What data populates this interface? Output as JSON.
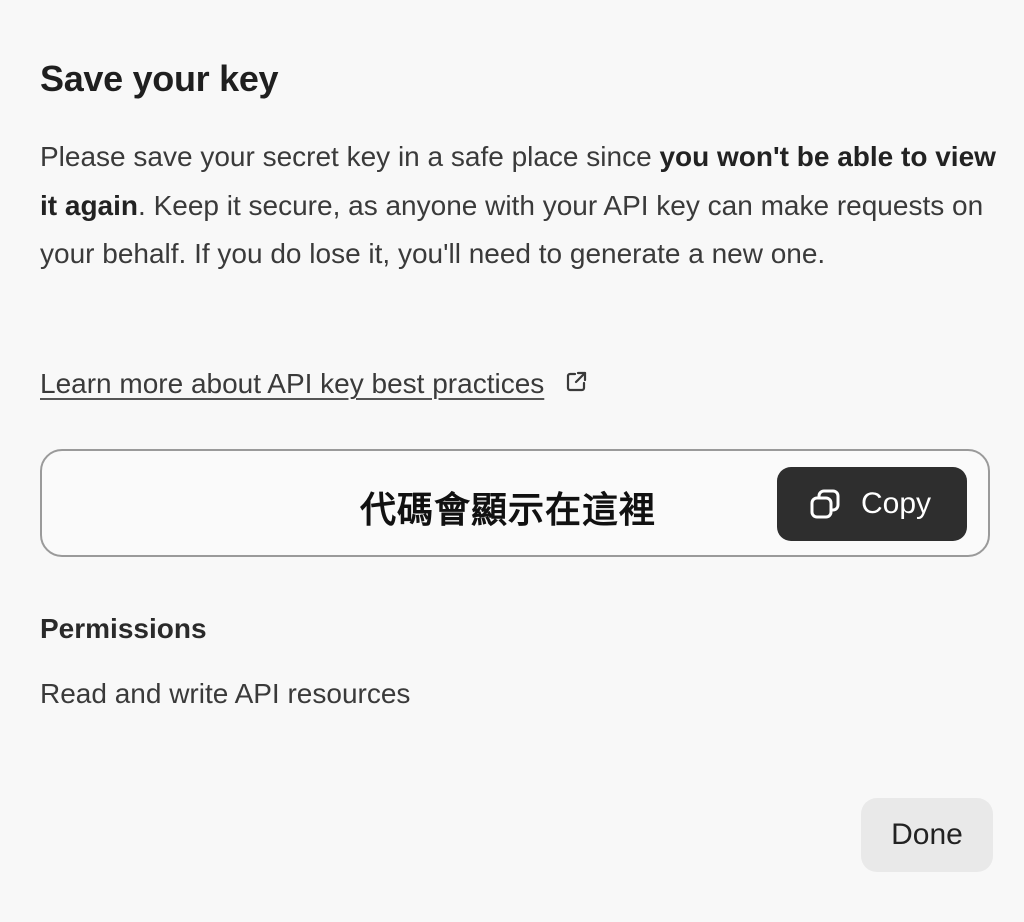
{
  "dialog": {
    "title": "Save your key",
    "description": {
      "part1": "Please save your secret key in a safe place since ",
      "bold": "you won't be able to view it again",
      "part2": ". Keep it secure, as anyone with your API key can make requests on your behalf. If you do lose it, you'll need to generate a new one."
    },
    "learn_more_link": "Learn more about API key best practices",
    "learn_more_icon": "external-link-icon",
    "key_placeholder": "代碼會顯示在這裡",
    "copy_button": {
      "label": "Copy",
      "icon": "copy-icon"
    },
    "permissions": {
      "heading": "Permissions",
      "value": "Read and write API resources"
    },
    "done_button": "Done"
  },
  "colors": {
    "background": "#f8f8f8",
    "copy_button_bg": "#2e2e2e",
    "done_button_bg": "#e9e9e9",
    "border": "#9a9a9a"
  }
}
